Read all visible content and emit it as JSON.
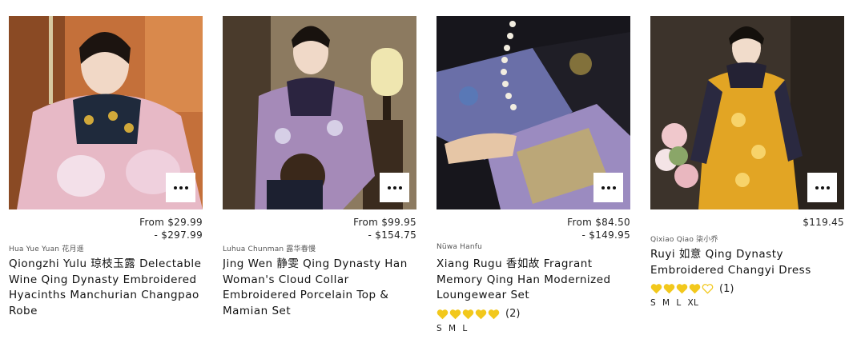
{
  "accent_gold": "#f2c81c",
  "products": [
    {
      "price_from": "From $29.99",
      "price_to": "- $297.99",
      "vendor": "Hua Yue Yuan 花月遥",
      "title": "Qiongzhi Yulu 琼枝玉露 Delectable Wine Qing Dynasty Embroidered Hyacinths Manchurian Changpao Robe",
      "image": "woman in pink embroidered qing robe"
    },
    {
      "price_from": "From $99.95",
      "price_to": "- $154.75",
      "vendor": "Luhua Chunman 露华春慢",
      "title": "Jing Wen 静雯 Qing Dynasty Han Woman's Cloud Collar Embroidered Porcelain Top & Mamian Set",
      "image": "woman in purple top holding fan beside lantern"
    },
    {
      "price_from": "From $84.50",
      "price_to": "- $149.95",
      "vendor": "Nüwa Hanfu",
      "title": "Xiang Rugu 香如故 Fragrant Memory Qing Han Modernized Loungewear Set",
      "rating": 5,
      "review_count": "(2)",
      "sizes": [
        "S",
        "M",
        "L"
      ],
      "image": "close-up of black embroidered sleeve with pearls"
    },
    {
      "price_single": "$119.45",
      "vendor": "Qixiao Qiao 柒小乔",
      "title": "Ruyi 如意 Qing Dynasty Embroidered Changyi Dress",
      "rating": 4,
      "review_count": "(1)",
      "sizes": [
        "S",
        "M",
        "L",
        "XL"
      ],
      "image": "woman in yellow changyi dress with flowers"
    }
  ]
}
